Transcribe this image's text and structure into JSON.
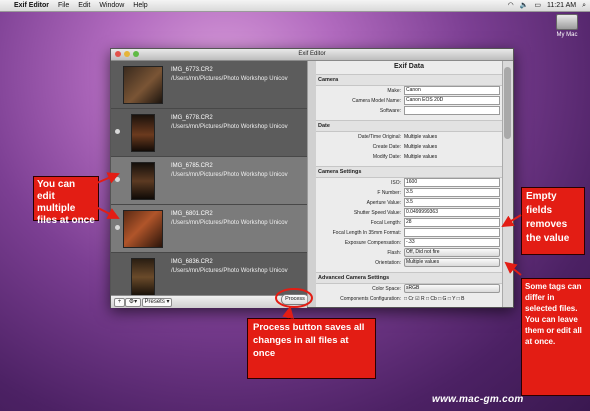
{
  "menubar": {
    "app": "Exif Editor",
    "items": [
      "File",
      "Edit",
      "Window",
      "Help"
    ],
    "clock": "11:21 AM"
  },
  "desktop": {
    "drive_label": "My Mac"
  },
  "window": {
    "title": "Exif Editor",
    "files": [
      {
        "name": "IMG_6773.CR2",
        "path": "/Users/mn/Pictures/Photo Workshop Unicov"
      },
      {
        "name": "IMG_6778.CR2",
        "path": "/Users/mn/Pictures/Photo Workshop Unicov"
      },
      {
        "name": "IMG_6785.CR2",
        "path": "/Users/mn/Pictures/Photo Workshop Unicov"
      },
      {
        "name": "IMG_6801.CR2",
        "path": "/Users/mn/Pictures/Photo Workshop Unicov"
      },
      {
        "name": "IMG_6836.CR2",
        "path": "/Users/mn/Pictures/Photo Workshop Unicov"
      }
    ],
    "bottom": {
      "add": "+",
      "gear": "⚙▾",
      "presets": "Presets ▾",
      "process": "Process"
    },
    "panel": {
      "title": "Exif Data",
      "camera": {
        "heading": "Camera",
        "make_label": "Make:",
        "make": "Canon",
        "model_label": "Camera Model Name:",
        "model": "Canon EOS 20D",
        "software_label": "Software:",
        "software": ""
      },
      "date": {
        "heading": "Date",
        "orig_label": "Date/Time Original:",
        "orig": "Multiple values",
        "create_label": "Create Date:",
        "create": "Multiple values",
        "modify_label": "Modify Date:",
        "modify": "Multiple values"
      },
      "settings": {
        "heading": "Camera Settings",
        "iso_label": "ISO:",
        "iso": "1600",
        "fnum_label": "F Number:",
        "fnum": "3.5",
        "aperture_label": "Aperture Value:",
        "aperture": "3.5",
        "shutter_label": "Shutter Speed Value:",
        "shutter": "0.0499999363",
        "focal_label": "Focal Length:",
        "focal": "28",
        "focal35_label": "Focal Length In 35mm Format:",
        "focal35": "",
        "exp_label": "Exposure Compensation:",
        "exp": "-.33",
        "flash_label": "Flash:",
        "flash": "Off, Did not fire",
        "orient_label": "Orientation:",
        "orient": "Multiple values"
      },
      "advanced": {
        "heading": "Advanced Camera Settings",
        "color_label": "Color Space:",
        "color": "sRGB",
        "comp_label": "Components Configuration:",
        "comp": "□ Cr ☑ R □ Cb □ G □ Y □ B"
      }
    }
  },
  "callouts": {
    "multi": "You can edit multiple files at once",
    "empty": "Empty fields removes the value",
    "process": "Process button saves all changes in all files at once",
    "differ": "Some tags can differ in selected files. You can leave them or edit all at once."
  },
  "watermark": "www.mac-gm.com"
}
